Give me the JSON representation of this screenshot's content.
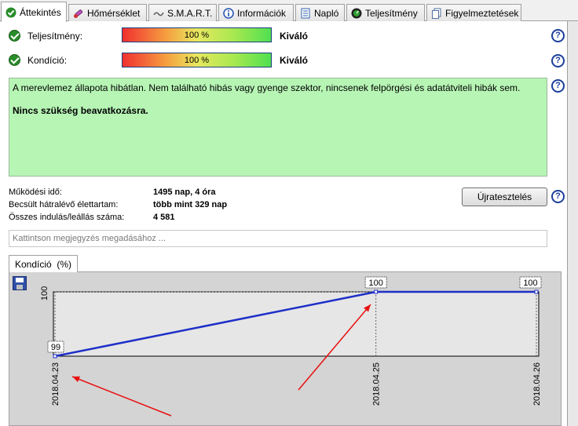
{
  "tabs": [
    {
      "label": "Áttekintés",
      "icon": "check-icon",
      "active": true
    },
    {
      "label": "Hőmérséklet",
      "icon": "thermometer-icon"
    },
    {
      "label": "S.M.A.R.T.",
      "icon": "smart-icon"
    },
    {
      "label": "Információk",
      "icon": "info-icon"
    },
    {
      "label": "Napló",
      "icon": "log-icon"
    },
    {
      "label": "Teljesítmény",
      "icon": "performance-icon"
    },
    {
      "label": "Figyelmeztetések",
      "icon": "alerts-icon"
    }
  ],
  "performance": {
    "label": "Teljesítmény:",
    "percent_text": "100 %",
    "value": 100,
    "rating": "Kiváló"
  },
  "condition": {
    "label": "Kondíció:",
    "percent_text": "100 %",
    "value": 100,
    "rating": "Kiváló"
  },
  "status": {
    "line1": "A merevlemez állapota hibátlan. Nem található hibás vagy gyenge szektor, nincsenek felpörgési és adatátviteli hibák sem.",
    "line2": "Nincs szükség beavatkozásra."
  },
  "info": {
    "uptime_label": "Működési idő:",
    "uptime_value": "1495 nap, 4 óra",
    "life_label": "Becsült hátralévő élettartam:",
    "life_value": "több mint 329 nap",
    "starts_label": "Összes indulás/leállás száma:",
    "starts_value": "4 581"
  },
  "retest_button": "Újratesztelés",
  "note_placeholder": "Kattintson megjegyzés megadásához ...",
  "chart_tab_label": "Kondíció  (%)",
  "colors": {
    "series": "#1e2fc8",
    "status_bg": "#b7f5b5",
    "arrow": "#e81010",
    "help": "#1c3f9c"
  },
  "chart_data": {
    "type": "line",
    "x": [
      "2018.04.23",
      "2018.04.25",
      "2018.04.26"
    ],
    "series": [
      {
        "values": [
          99,
          100,
          100
        ]
      }
    ],
    "ytick_labels": [
      "100"
    ],
    "data_labels": [
      "99",
      "100",
      "100"
    ],
    "grid": true
  }
}
